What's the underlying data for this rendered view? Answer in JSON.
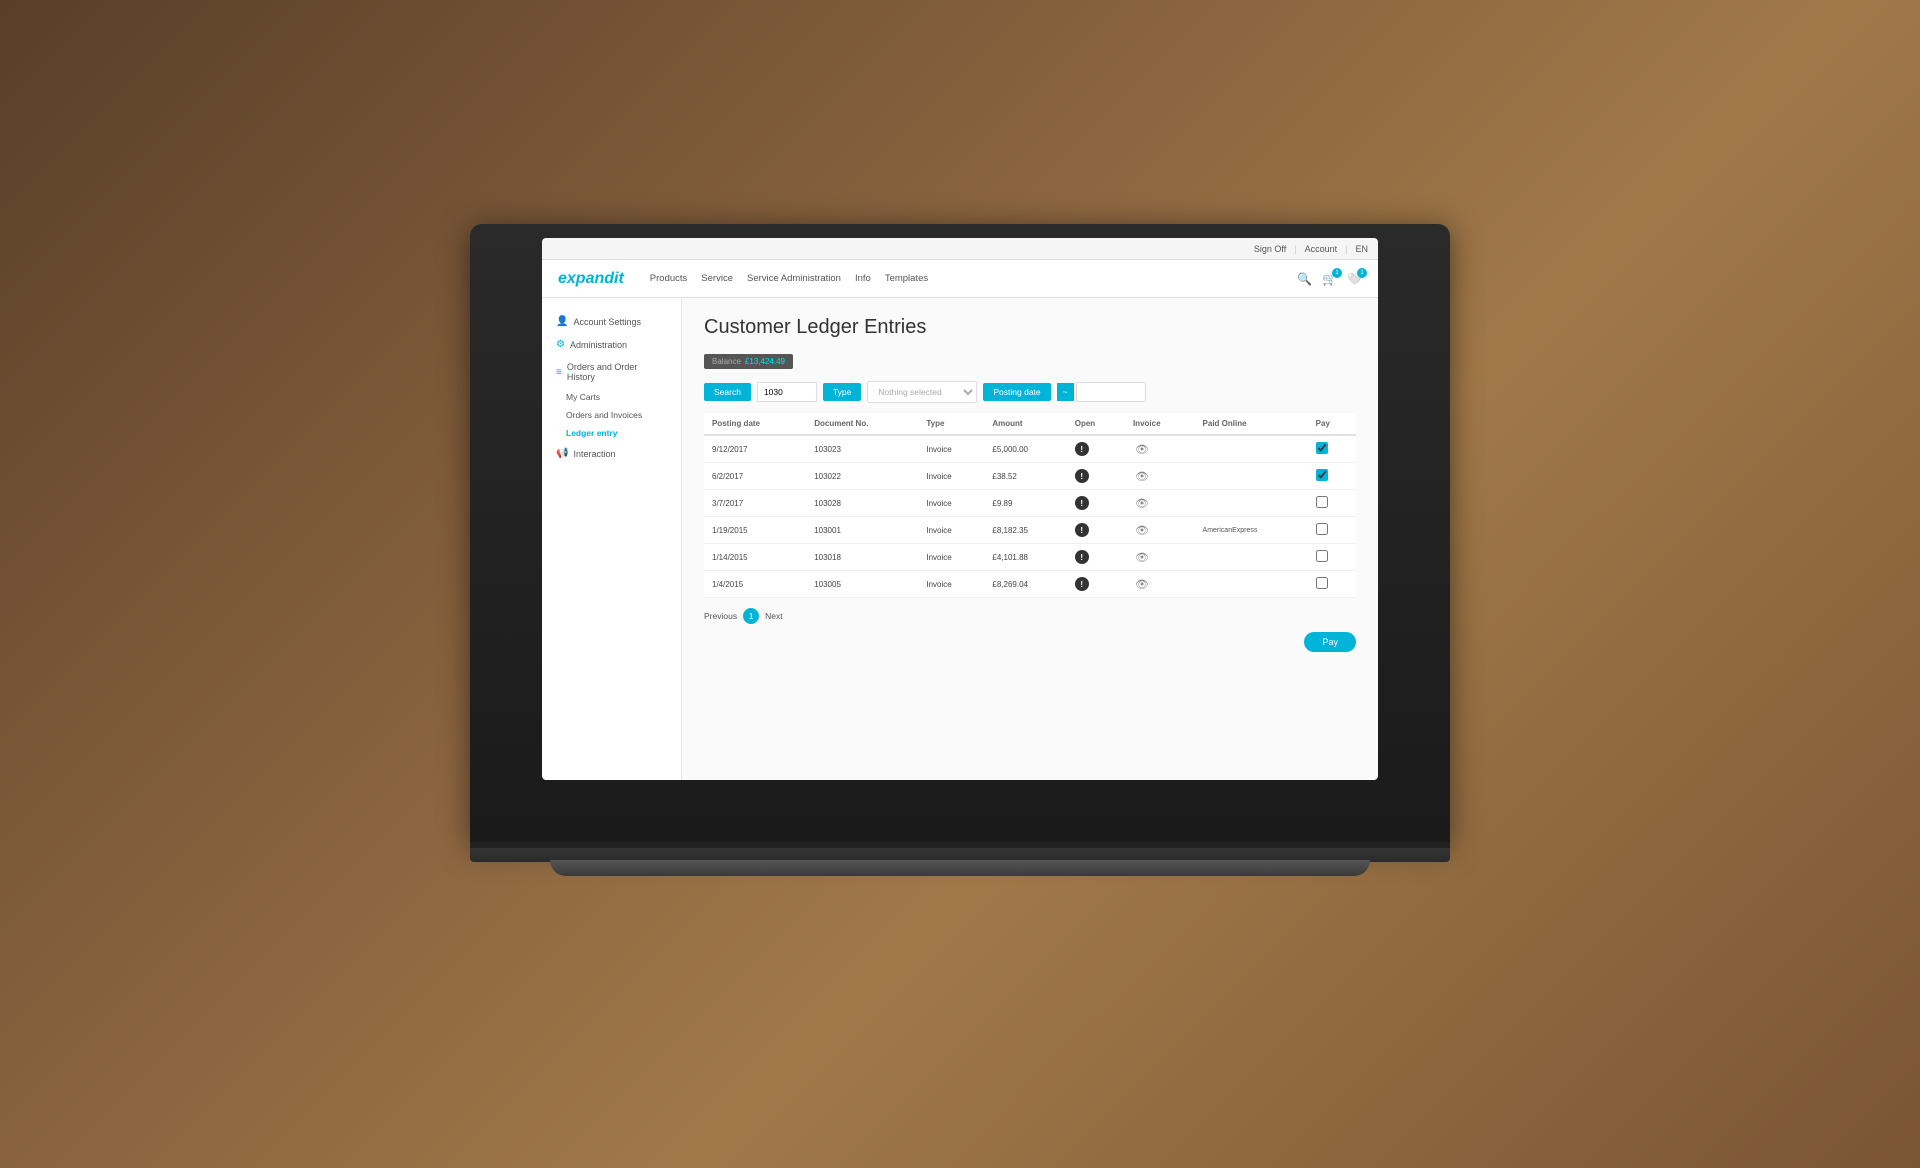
{
  "topbar": {
    "sign_off": "Sign Off",
    "account": "Account",
    "language": "EN"
  },
  "nav": {
    "brand": "expandit",
    "items": [
      {
        "label": "Products"
      },
      {
        "label": "Service"
      },
      {
        "label": "Service Administration"
      },
      {
        "label": "Info"
      },
      {
        "label": "Templates"
      }
    ]
  },
  "sidebar": {
    "items": [
      {
        "label": "Account Settings",
        "icon": "👤",
        "active": false
      },
      {
        "label": "Administration",
        "icon": "⚙",
        "active": false
      },
      {
        "label": "Orders and Order History",
        "icon": "📋",
        "active": false
      },
      {
        "label": "Interaction",
        "icon": "💬",
        "active": false
      }
    ],
    "subitems": [
      {
        "label": "My Carts",
        "parent": "Orders and Order History"
      },
      {
        "label": "Orders and Invoices",
        "parent": "Orders and Order History"
      },
      {
        "label": "Ledger entry",
        "parent": "Orders and Order History",
        "active": true
      }
    ]
  },
  "page": {
    "title": "Customer Ledger Entries",
    "balance_label": "Balance",
    "balance_value": "£13,424.49"
  },
  "filters": {
    "search_label": "Search",
    "search_value": "1030",
    "type_label": "Type",
    "type_placeholder": "Nothing selected",
    "posting_date_label": "Posting date",
    "date_separator": "~"
  },
  "table": {
    "columns": [
      "Posting date",
      "Document No.",
      "Type",
      "Amount",
      "Open",
      "Invoice",
      "Paid Online",
      "Pay"
    ],
    "rows": [
      {
        "posting_date": "9/12/2017",
        "document_no": "103023",
        "type": "Invoice",
        "amount": "£5,000.00",
        "open": true,
        "invoice": true,
        "paid_online": "",
        "pay": "checked"
      },
      {
        "posting_date": "6/2/2017",
        "document_no": "103022",
        "type": "Invoice",
        "amount": "£38.52",
        "open": true,
        "invoice": true,
        "paid_online": "",
        "pay": "checked"
      },
      {
        "posting_date": "3/7/2017",
        "document_no": "103028",
        "type": "Invoice",
        "amount": "£9.89",
        "open": true,
        "invoice": true,
        "paid_online": "",
        "pay": "unchecked"
      },
      {
        "posting_date": "1/19/2015",
        "document_no": "103001",
        "type": "Invoice",
        "amount": "£8,182.35",
        "open": true,
        "invoice": true,
        "paid_online": "AmericanExpress",
        "pay": "unchecked"
      },
      {
        "posting_date": "1/14/2015",
        "document_no": "103018",
        "type": "Invoice",
        "amount": "£4,101.88",
        "open": true,
        "invoice": true,
        "paid_online": "",
        "pay": "unchecked"
      },
      {
        "posting_date": "1/4/2015",
        "document_no": "103005",
        "type": "Invoice",
        "amount": "£8,269.04",
        "open": true,
        "invoice": true,
        "paid_online": "",
        "pay": "unchecked"
      }
    ]
  },
  "pagination": {
    "previous": "Previous",
    "current": "1",
    "next": "Next"
  },
  "pay_button": "Pay",
  "colors": {
    "accent": "#00b4d8",
    "dark": "#333",
    "light_bg": "#fafafa"
  }
}
